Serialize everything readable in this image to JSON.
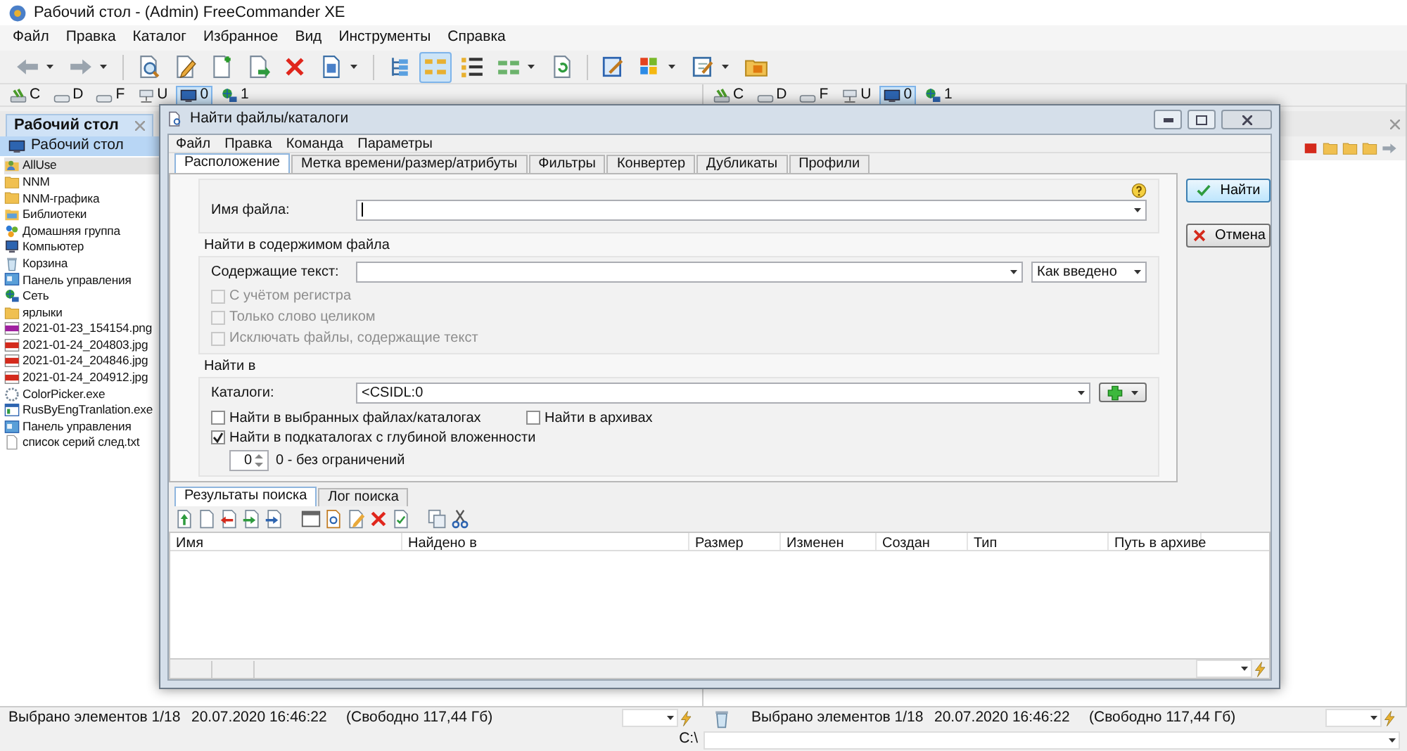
{
  "window": {
    "title": "Рабочий стол - (Admin) FreeCommander XE"
  },
  "menu": [
    "Файл",
    "Правка",
    "Каталог",
    "Избранное",
    "Вид",
    "Инструменты",
    "Справка"
  ],
  "toolbar": [
    {
      "buttons": [
        {
          "kind": "back",
          "selected": false,
          "dropdown": true
        },
        {
          "kind": "forward",
          "selected": false,
          "dropdown": true
        }
      ]
    },
    {
      "buttons": [
        {
          "kind": "view",
          "selected": false,
          "dropdown": false
        },
        {
          "kind": "edit",
          "selected": false,
          "dropdown": false
        },
        {
          "kind": "copy",
          "selected": false,
          "dropdown": false
        },
        {
          "kind": "move",
          "selected": false,
          "dropdown": false
        },
        {
          "kind": "delete",
          "selected": false,
          "dropdown": false
        },
        {
          "kind": "pack",
          "selected": false,
          "dropdown": true
        }
      ]
    },
    {
      "buttons": [
        {
          "kind": "tree",
          "selected": false,
          "dropdown": false
        },
        {
          "kind": "details",
          "selected": true,
          "dropdown": false
        },
        {
          "kind": "list",
          "selected": false,
          "dropdown": false
        },
        {
          "kind": "thumbs",
          "selected": false,
          "dropdown": true
        },
        {
          "kind": "refresh",
          "selected": false,
          "dropdown": false
        }
      ]
    },
    {
      "buttons": [
        {
          "kind": "props",
          "selected": false,
          "dropdown": false
        },
        {
          "kind": "windows",
          "selected": false,
          "dropdown": true
        },
        {
          "kind": "notes",
          "selected": false,
          "dropdown": true
        },
        {
          "kind": "sfolder",
          "selected": false,
          "dropdown": false
        }
      ]
    }
  ],
  "left_panel": {
    "drives": [
      {
        "label": "C",
        "kind": "system",
        "selected": false
      },
      {
        "label": "D",
        "kind": "disk",
        "selected": false
      },
      {
        "label": "F",
        "kind": "disk",
        "selected": false
      },
      {
        "label": "U",
        "kind": "netdrive",
        "selected": false
      },
      {
        "label": "0",
        "kind": "desktop",
        "selected": true
      },
      {
        "label": "1",
        "kind": "network",
        "selected": false
      }
    ],
    "tab": "Рабочий стол",
    "folder": "Рабочий стол",
    "items": [
      {
        "name": "AllUse",
        "kind": "user",
        "selected": true
      },
      {
        "name": "NNM",
        "kind": "folder",
        "selected": false
      },
      {
        "name": "NNM-графика",
        "kind": "folder",
        "selected": false
      },
      {
        "name": "Библиотеки",
        "kind": "library",
        "selected": false
      },
      {
        "name": "Домашняя группа",
        "kind": "homegroup",
        "selected": false
      },
      {
        "name": "Компьютер",
        "kind": "computer",
        "selected": false
      },
      {
        "name": "Корзина",
        "kind": "trash",
        "selected": false
      },
      {
        "name": "Панель управления",
        "kind": "control",
        "selected": false
      },
      {
        "name": "Сеть",
        "kind": "network",
        "selected": false
      },
      {
        "name": "ярлыки",
        "kind": "folder",
        "selected": false
      },
      {
        "name": "2021-01-23_154154.png",
        "kind": "png",
        "selected": false
      },
      {
        "name": "2021-01-24_204803.jpg",
        "kind": "jpg",
        "selected": false
      },
      {
        "name": "2021-01-24_204846.jpg",
        "kind": "jpg",
        "selected": false
      },
      {
        "name": "2021-01-24_204912.jpg",
        "kind": "jpg",
        "selected": false
      },
      {
        "name": "ColorPicker.exe",
        "kind": "exe",
        "selected": false
      },
      {
        "name": "RusByEngTranlation.exe",
        "kind": "app",
        "selected": false
      },
      {
        "name": "Панель управления",
        "kind": "control",
        "selected": false
      },
      {
        "name": "список серий след.txt",
        "kind": "txt",
        "selected": false
      }
    ],
    "status": {
      "selection": "Выбрано элементов 1/18",
      "date": "20.07.2020 16:46:22",
      "free": "(Свободно 117,44 Гб)"
    }
  },
  "right_panel": {
    "drives": [
      {
        "label": "C",
        "kind": "system",
        "selected": false
      },
      {
        "label": "D",
        "kind": "disk",
        "selected": false
      },
      {
        "label": "F",
        "kind": "disk",
        "selected": false
      },
      {
        "label": "U",
        "kind": "netdrive",
        "selected": false
      },
      {
        "label": "0",
        "kind": "desktop",
        "selected": true
      },
      {
        "label": "1",
        "kind": "network",
        "selected": false
      }
    ],
    "status": {
      "selection": "Выбрано элементов 1/18",
      "date": "20.07.2020 16:46:22",
      "free": "(Свободно 117,44 Гб)"
    }
  },
  "path_bar": {
    "label": "C:\\"
  },
  "dialog": {
    "title": "Найти файлы/каталоги",
    "menu": [
      "Файл",
      "Правка",
      "Команда",
      "Параметры"
    ],
    "tabs": [
      {
        "label": "Расположение",
        "selected": true
      },
      {
        "label": "Метка времени/размер/атрибуты",
        "selected": false
      },
      {
        "label": "Фильтры",
        "selected": false
      },
      {
        "label": "Конвертер",
        "selected": false
      },
      {
        "label": "Дубликаты",
        "selected": false
      },
      {
        "label": "Профили",
        "selected": false
      }
    ],
    "filename_label": "Имя файла:",
    "content_section": {
      "title": "Найти в содержимом файла",
      "label": "Содержащие текст:",
      "mode": "Как введено",
      "options": [
        {
          "label": "С учётом регистра",
          "checked": false,
          "disabled": true
        },
        {
          "label": "Только слово целиком",
          "checked": false,
          "disabled": true
        },
        {
          "label": "Исключать файлы, содержащие текст",
          "checked": false,
          "disabled": true
        }
      ]
    },
    "location_section": {
      "title": "Найти в",
      "label": "Каталоги:",
      "value": "<CSIDL:0",
      "options": [
        {
          "label": "Найти в выбранных файлах/каталогах",
          "checked": false,
          "disabled": false
        },
        {
          "label": "Найти в архивах",
          "checked": false,
          "disabled": false
        },
        {
          "label": "Найти в подкаталогах с глубиной вложенности",
          "checked": true,
          "disabled": false
        }
      ],
      "depth": "0",
      "depth_hint": "0 - без ограничений"
    },
    "buttons": [
      {
        "label": "Найти",
        "kind": "ok"
      },
      {
        "label": "Отмена",
        "kind": "cancel"
      }
    ],
    "result_tabs": [
      {
        "label": "Результаты поиска",
        "selected": true
      },
      {
        "label": "Лог поиска",
        "selected": false
      }
    ],
    "result_toolbar": [
      {
        "buttons": [
          {
            "kind": "up"
          },
          {
            "kind": "doc"
          },
          {
            "kind": "outred"
          },
          {
            "kind": "ingreen"
          },
          {
            "kind": "inblue"
          }
        ]
      },
      {
        "buttons": [
          {
            "kind": "panel"
          },
          {
            "kind": "docsearch"
          },
          {
            "kind": "docedit"
          },
          {
            "kind": "delete"
          },
          {
            "kind": "check"
          }
        ]
      },
      {
        "buttons": [
          {
            "kind": "copydoc"
          },
          {
            "kind": "cut"
          }
        ]
      }
    ],
    "columns": [
      "Имя",
      "Найдено в",
      "Размер",
      "Изменен",
      "Создан",
      "Тип",
      "Путь в архиве"
    ]
  }
}
